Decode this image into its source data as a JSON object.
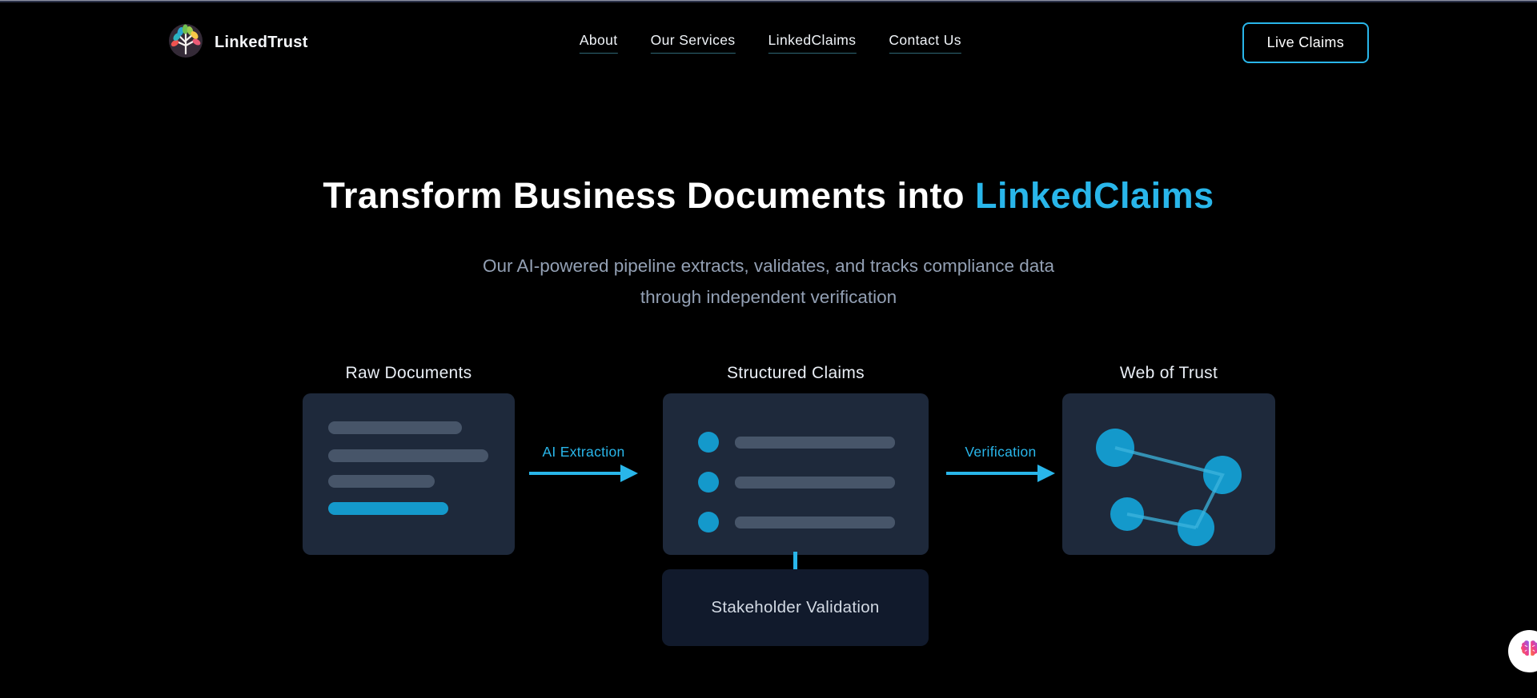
{
  "header": {
    "brand": "LinkedTrust",
    "nav": [
      {
        "label": "About"
      },
      {
        "label": "Our Services"
      },
      {
        "label": "LinkedClaims"
      },
      {
        "label": "Contact Us"
      }
    ],
    "cta_label": "Live Claims"
  },
  "hero": {
    "title_prefix": "Transform Business Documents into ",
    "title_accent": "LinkedClaims",
    "subtitle_line1": "Our AI-powered pipeline extracts, validates, and tracks compliance data",
    "subtitle_line2": "through independent verification"
  },
  "pipeline": {
    "stages": [
      {
        "title": "Raw Documents"
      },
      {
        "title": "Structured Claims"
      },
      {
        "title": "Web of Trust"
      }
    ],
    "arrows": [
      {
        "label": "AI Extraction"
      },
      {
        "label": "Verification"
      }
    ],
    "validation_label": "Stakeholder Validation"
  },
  "icons": {
    "logo": "tree-logo-icon",
    "widget": "brain-icon"
  },
  "colors": {
    "background": "#000000",
    "accent_cyan": "#29b6ea",
    "diagram_fill_cyan": "#1499cb",
    "card_background": "#1e293b",
    "validation_background": "#111a2c",
    "placeholder_bar": "#475569",
    "subtitle_gray": "#93a0b4"
  }
}
